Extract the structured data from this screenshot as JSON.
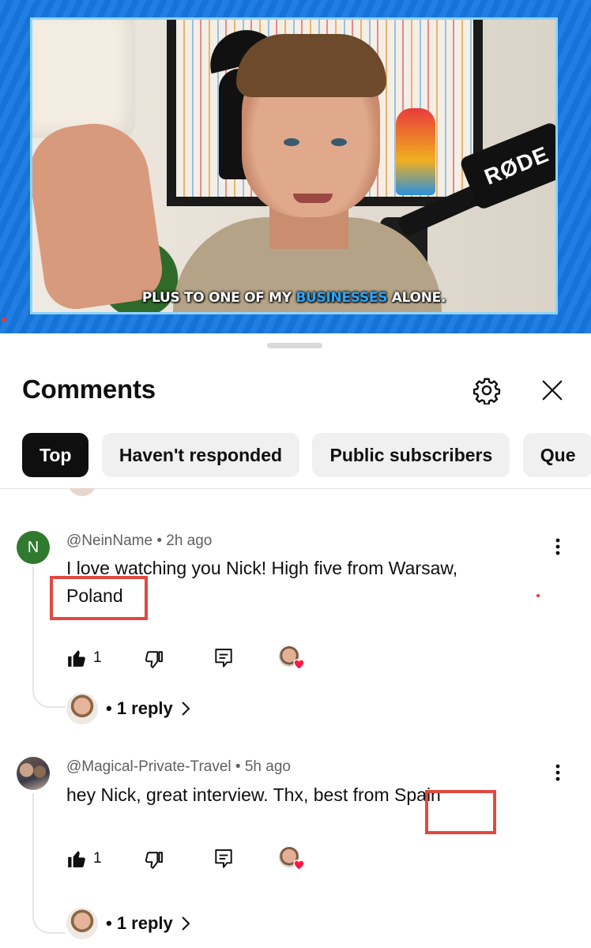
{
  "video": {
    "caption_part1": "PLUS TO ONE OF MY ",
    "caption_highlight": "BUSINESSES",
    "caption_part2": " ALONE.",
    "mic_brand": "RØDE"
  },
  "sheet": {
    "title": "Comments",
    "chips": [
      "Top",
      "Haven't responded",
      "Public subscribers",
      "Que"
    ],
    "active_chip": "Top"
  },
  "comments": [
    {
      "avatar_letter": "N",
      "author": "@NeinName",
      "time": "2h ago",
      "text_line1": "I love watching you Nick! High five from Warsaw,",
      "text_line2": "Poland",
      "likes": "1",
      "replies": "1 reply"
    },
    {
      "author": "@Magical-Private-Travel",
      "time": "5h ago",
      "text_main": "hey Nick, great interview.  Thx, best from ",
      "text_highlight": "Spain",
      "likes": "1",
      "replies": "1 reply"
    }
  ],
  "colors": {
    "accent_video_bg": "#1677e0",
    "chip_active_bg": "#0f0f0f",
    "chip_bg": "#f0f0f0",
    "highlight_box": "#e0493f",
    "heart": "#ff1744",
    "avatar_n": "#2f7a2e"
  },
  "icons": [
    "gear-icon",
    "close-icon",
    "like-icon",
    "dislike-icon",
    "reply-icon",
    "more-vert-icon",
    "heart-icon",
    "chevron-right-icon"
  ]
}
